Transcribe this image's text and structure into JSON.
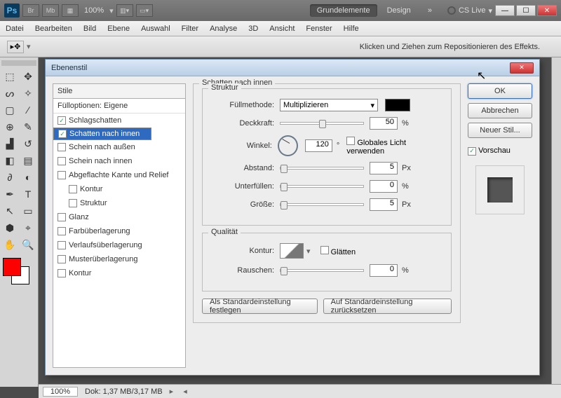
{
  "app": {
    "logo": "Ps",
    "br": "Br",
    "mb": "Mb",
    "zoom": "100%",
    "workspaceA": "Grundelemente",
    "workspaceB": "Design",
    "more": "»",
    "cslive": "CS Live"
  },
  "menu": [
    "Datei",
    "Bearbeiten",
    "Bild",
    "Ebene",
    "Auswahl",
    "Filter",
    "Analyse",
    "3D",
    "Ansicht",
    "Fenster",
    "Hilfe"
  ],
  "optbar": {
    "hint": "Klicken und Ziehen zum Repositionieren des Effekts."
  },
  "dialog": {
    "title": "Ebenenstil",
    "stylesHeader": "Stile",
    "fillOptions": "Fülloptionen: Eigene",
    "items": [
      {
        "label": "Schlagschatten",
        "checked": true,
        "sub": false
      },
      {
        "label": "Schatten nach innen",
        "checked": true,
        "sub": false,
        "selected": true
      },
      {
        "label": "Schein nach außen",
        "checked": false,
        "sub": false
      },
      {
        "label": "Schein nach innen",
        "checked": false,
        "sub": false
      },
      {
        "label": "Abgeflachte Kante und Relief",
        "checked": false,
        "sub": false
      },
      {
        "label": "Kontur",
        "checked": false,
        "sub": true
      },
      {
        "label": "Struktur",
        "checked": false,
        "sub": true
      },
      {
        "label": "Glanz",
        "checked": false,
        "sub": false
      },
      {
        "label": "Farbüberlagerung",
        "checked": false,
        "sub": false
      },
      {
        "label": "Verlaufsüberlagerung",
        "checked": false,
        "sub": false
      },
      {
        "label": "Musterüberlagerung",
        "checked": false,
        "sub": false
      },
      {
        "label": "Kontur",
        "checked": false,
        "sub": false
      }
    ],
    "panelTitle": "Schatten nach innen",
    "struct": {
      "legend": "Struktur",
      "fillMethodLabel": "Füllmethode:",
      "fillMethod": "Multiplizieren",
      "opacityLabel": "Deckkraft:",
      "opacity": "50",
      "opacityUnit": "%",
      "angleLabel": "Winkel:",
      "angle": "120",
      "angleUnit": "°",
      "globalLight": "Globales Licht verwenden",
      "distLabel": "Abstand:",
      "dist": "5",
      "distUnit": "Px",
      "chokeLabel": "Unterfüllen:",
      "choke": "0",
      "chokeUnit": "%",
      "sizeLabel": "Größe:",
      "size": "5",
      "sizeUnit": "Px"
    },
    "qual": {
      "legend": "Qualität",
      "contourLabel": "Kontur:",
      "smooth": "Glätten",
      "noiseLabel": "Rauschen:",
      "noise": "0",
      "noiseUnit": "%"
    },
    "defaults": {
      "set": "Als Standardeinstellung festlegen",
      "reset": "Auf Standardeinstellung zurücksetzen"
    },
    "buttons": {
      "ok": "OK",
      "cancel": "Abbrechen",
      "newStyle": "Neuer Stil...",
      "preview": "Vorschau"
    }
  },
  "status": {
    "zoom": "100%",
    "doc": "Dok: 1,37 MB/3,17 MB"
  }
}
